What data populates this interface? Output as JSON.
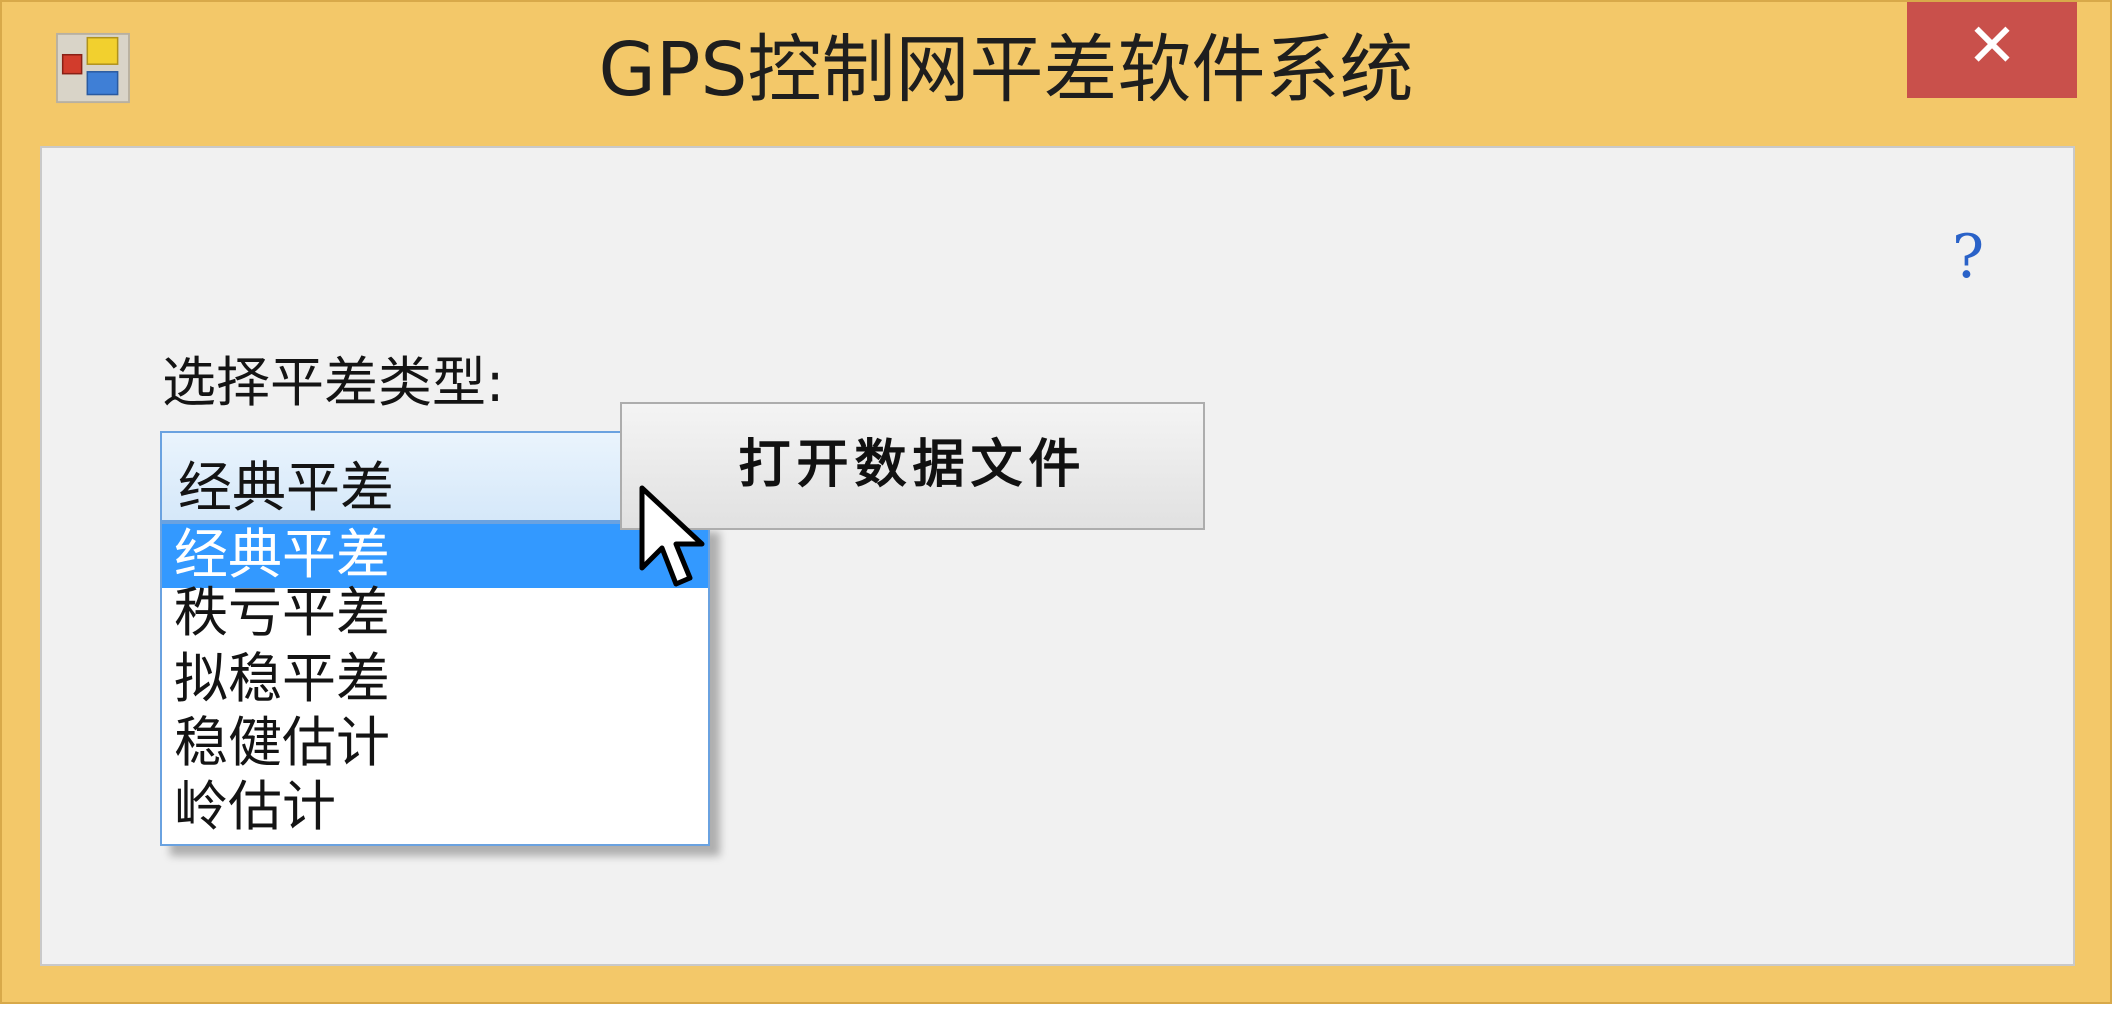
{
  "window": {
    "title": "GPS控制网平差软件系统",
    "close_label": "✕"
  },
  "form": {
    "help_label": "?",
    "type_label": "选择平差类型:",
    "combo": {
      "selected": "经典平差",
      "options": [
        "经典平差",
        "秩亏平差",
        "拟稳平差",
        "稳健估计",
        "岭估计"
      ],
      "highlighted_index": 0
    },
    "open_button_label": "打开数据文件"
  },
  "colors": {
    "frame": "#f3c869",
    "close": "#c9504b",
    "highlight": "#3399ff",
    "help": "#2a62c8"
  },
  "icons": {
    "app": "app-icon",
    "close": "close-icon",
    "help": "help-icon",
    "chevron": "chevron-down-icon",
    "cursor": "mouse-cursor-icon"
  }
}
